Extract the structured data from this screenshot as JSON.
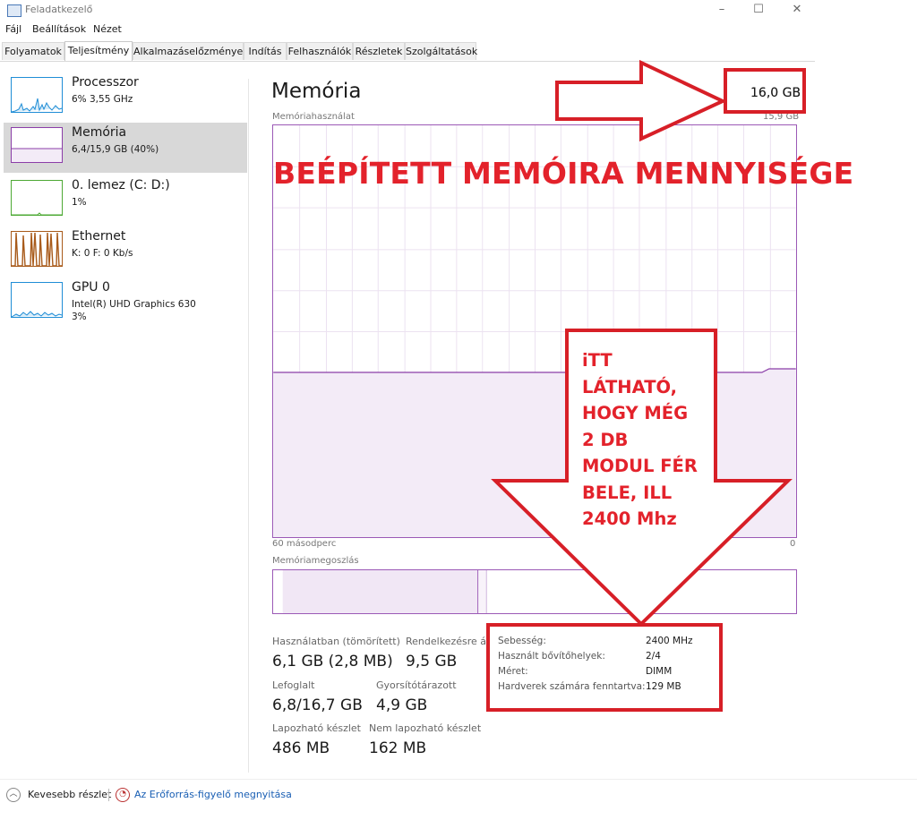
{
  "window": {
    "title": "Feladatkezelő"
  },
  "menu": [
    "Fájl",
    "Beállítások",
    "Nézet"
  ],
  "tabs": [
    "Folyamatok",
    "Teljesítmény",
    "Alkalmazáselőzmények",
    "Indítás",
    "Felhasználók",
    "Részletek",
    "Szolgáltatások"
  ],
  "active_tab": "Teljesítmény",
  "sidebar": {
    "items": [
      {
        "title": "Processzor",
        "sub1": "6% 3,55 GHz",
        "sub2": "",
        "color": "#1f8dd6"
      },
      {
        "title": "Memória",
        "sub1": "6,4/15,9 GB (40%)",
        "sub2": "",
        "color": "#8b3ea8"
      },
      {
        "title": "0. lemez (C: D:)",
        "sub1": "1%",
        "sub2": "",
        "color": "#4da934"
      },
      {
        "title": "Ethernet",
        "sub1": "K: 0 F: 0 Kb/s",
        "sub2": "",
        "color": "#a85a1a"
      },
      {
        "title": "GPU 0",
        "sub1": "Intel(R) UHD Graphics 630",
        "sub2": "3%",
        "color": "#1f8dd6"
      }
    ]
  },
  "main": {
    "title": "Memória",
    "total": "16,0 GB",
    "usage_label": "Memóriahasználat",
    "usage_max": "15,9 GB",
    "time_left": "60 másodperc",
    "time_right": "0",
    "composition_label": "Memóriamegoszlás",
    "usage_fraction": 0.4
  },
  "stats": {
    "in_use_label": "Használatban (tömörített)",
    "in_use_value": "6,1 GB (2,8 MB)",
    "available_label": "Rendelkezésre áll",
    "available_value": "9,5 GB",
    "committed_label": "Lefoglalt",
    "committed_value": "6,8/16,7 GB",
    "cached_label": "Gyorsítótárazott",
    "cached_value": "4,9 GB",
    "paged_label": "Lapozható készlet",
    "paged_value": "486 MB",
    "nonpaged_label": "Nem lapozható készlet",
    "nonpaged_value": "162 MB"
  },
  "info": [
    {
      "label": "Sebesség:",
      "value": "2400 MHz"
    },
    {
      "label": "Használt bővítőhelyek:",
      "value": "2/4"
    },
    {
      "label": "Méret:",
      "value": "DIMM"
    },
    {
      "label": "Hardverek számára fenntartva:",
      "value": "129 MB"
    }
  ],
  "annotations": {
    "heading": "BEÉPÍTETT MEMÓIRA MENNYISÉGE",
    "arrow_lines": [
      "iTT",
      "LÁTHATÓ,",
      "HOGY MÉG",
      "2 DB",
      "MODUL FÉR",
      "BELE, ILL",
      "2400 Mhz"
    ]
  },
  "footer": {
    "less_details": "Kevesebb részlet",
    "resmon_link": "Az Erőforrás-figyelő megnyitása"
  },
  "colors": {
    "memory": "#8b3ea8",
    "memory_fill": "#f3ebf7",
    "annotation": "#d71f27"
  }
}
